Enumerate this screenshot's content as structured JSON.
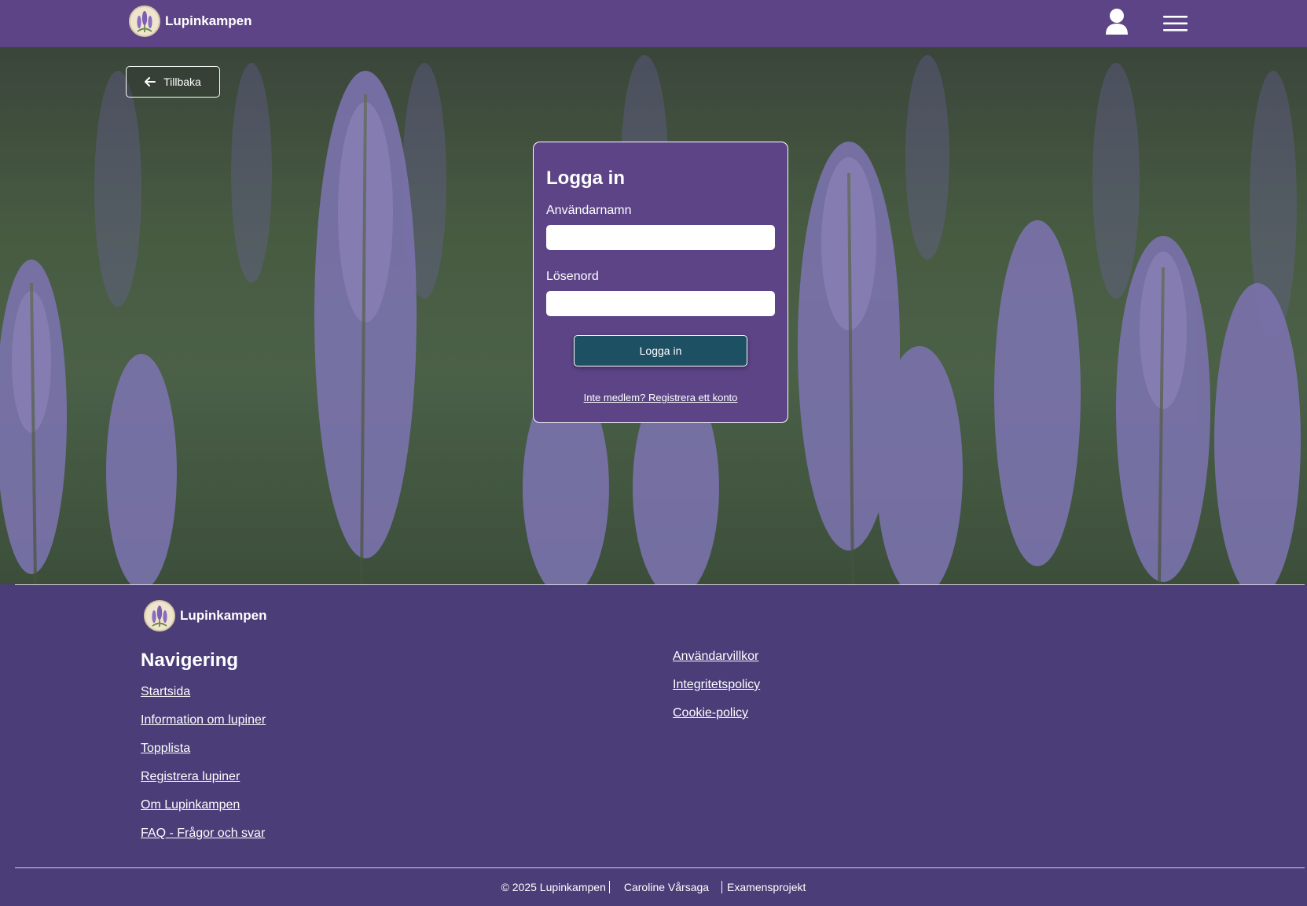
{
  "header": {
    "brand_name": "Lupinkampen",
    "icons": {
      "logo": "lupine-logo-icon",
      "user": "user-icon",
      "menu": "hamburger-menu-icon"
    }
  },
  "hero": {
    "back_label": "Tillbaka"
  },
  "login": {
    "title": "Logga in",
    "username_label": "Användarnamn",
    "username_value": "",
    "password_label": "Lösenord",
    "password_value": "",
    "submit_label": "Logga in",
    "register_link": "Inte medlem? Registrera ett konto"
  },
  "footer": {
    "brand_name": "Lupinkampen",
    "nav_heading": "Navigering",
    "nav_links": [
      "Startsida",
      "Information om lupiner",
      "Topplista",
      "Registrera lupiner",
      "Om Lupinkampen",
      "FAQ - Frågor och svar"
    ],
    "legal_links": [
      "Användarvillkor",
      "Integritetspolicy",
      "Cookie-policy"
    ],
    "copyright": "© 2025 Lupinkampen",
    "author": "Caroline Vårsaga",
    "project": "Examensprojekt"
  },
  "colors": {
    "header_bg": "#5c4487",
    "footer_bg": "#4a3d78",
    "card_bg": "#5c4487",
    "button_bg": "#1e5064"
  }
}
